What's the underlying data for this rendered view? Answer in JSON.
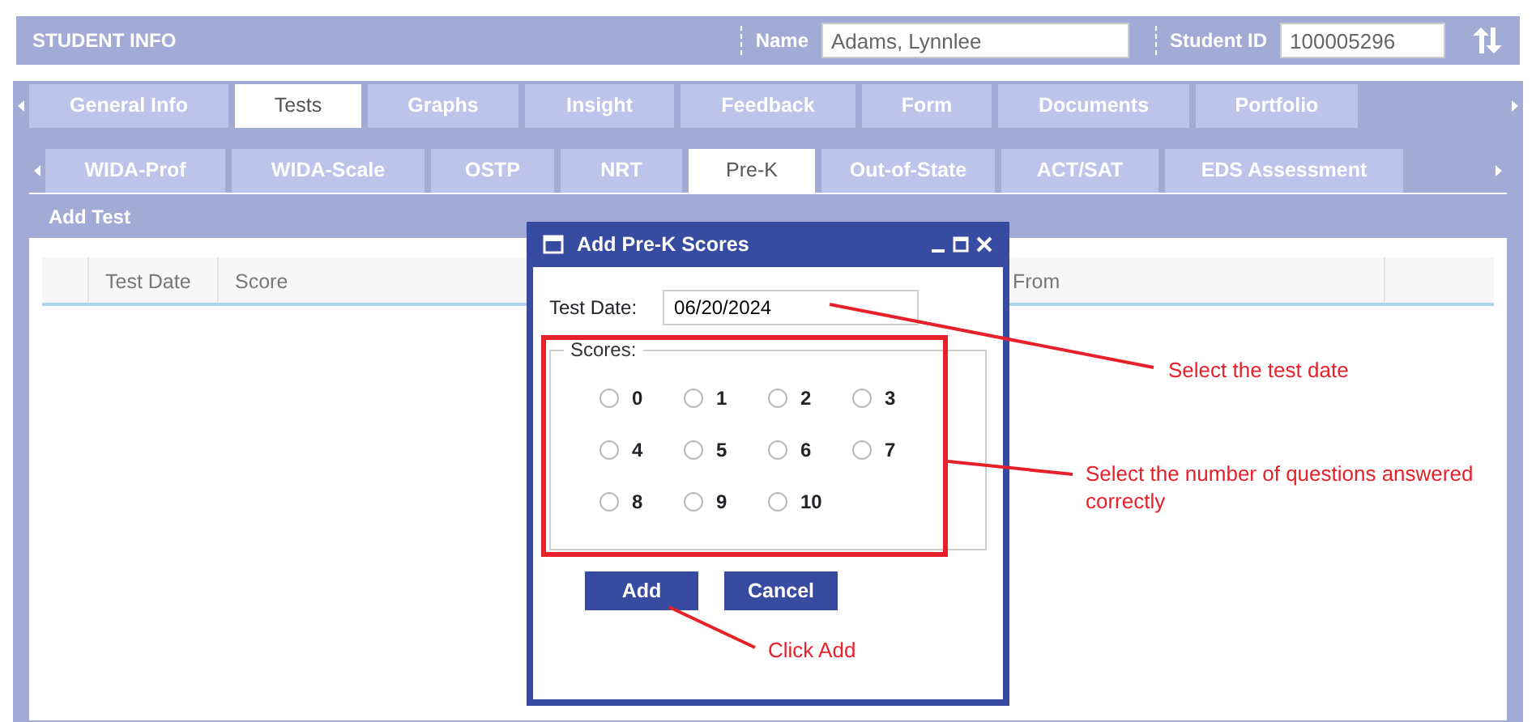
{
  "header": {
    "title": "STUDENT INFO",
    "name_label": "Name",
    "name_value": "Adams, Lynnlee",
    "id_label": "Student ID",
    "id_value": "100005296"
  },
  "tabs": [
    {
      "label": "General Info",
      "selected": false
    },
    {
      "label": "Tests",
      "selected": true
    },
    {
      "label": "Graphs",
      "selected": false
    },
    {
      "label": "Insight",
      "selected": false
    },
    {
      "label": "Feedback",
      "selected": false
    },
    {
      "label": "Form",
      "selected": false
    },
    {
      "label": "Documents",
      "selected": false
    },
    {
      "label": "Portfolio",
      "selected": false
    }
  ],
  "subtabs": [
    {
      "label": "WIDA-Prof",
      "selected": false
    },
    {
      "label": "WIDA-Scale",
      "selected": false
    },
    {
      "label": "OSTP",
      "selected": false
    },
    {
      "label": "NRT",
      "selected": false
    },
    {
      "label": "Pre-K",
      "selected": true
    },
    {
      "label": "Out-of-State",
      "selected": false
    },
    {
      "label": "ACT/SAT",
      "selected": false
    },
    {
      "label": "EDS Assessment",
      "selected": false
    }
  ],
  "panel_title": "Add Test",
  "table": {
    "columns": [
      "Test Date",
      "Score",
      "From"
    ]
  },
  "dialog": {
    "title": "Add Pre-K Scores",
    "date_label": "Test Date:",
    "date_value": "06/20/2024",
    "scores_legend": "Scores:",
    "scores": [
      {
        "label": "0",
        "selected": false
      },
      {
        "label": "1",
        "selected": false
      },
      {
        "label": "2",
        "selected": false
      },
      {
        "label": "3",
        "selected": false
      },
      {
        "label": "4",
        "selected": false
      },
      {
        "label": "5",
        "selected": false
      },
      {
        "label": "6",
        "selected": false
      },
      {
        "label": "7",
        "selected": false
      },
      {
        "label": "8",
        "selected": false
      },
      {
        "label": "9",
        "selected": false
      },
      {
        "label": "10",
        "selected": false
      }
    ],
    "buttons": [
      "Add",
      "Cancel"
    ]
  },
  "annotations": [
    "Select the test date",
    "Select the number of questions answered correctly",
    "Click Add"
  ]
}
